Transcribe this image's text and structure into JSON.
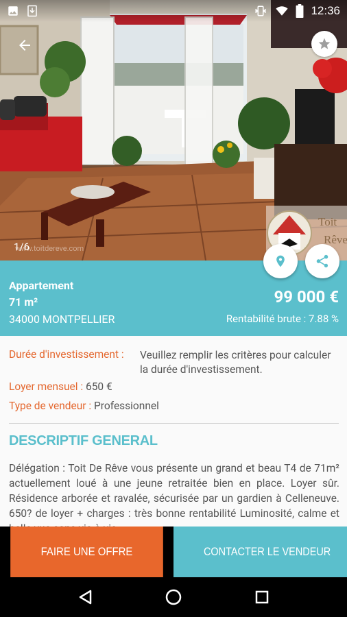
{
  "status_bar": {
    "time": "12:36",
    "icons": [
      "image-icon",
      "download-icon",
      "vibrate-icon",
      "wifi-icon",
      "battery-icon"
    ]
  },
  "gallery": {
    "counter": "1/6",
    "watermark": "www.toitdereve.com",
    "logo_text_top": "Toit",
    "logo_text_bottom": "Rêve"
  },
  "listing": {
    "type": "Appartement",
    "area": "71 m²",
    "city": "34000 MONTPELLIER",
    "price": "99 000 €",
    "yield": "Rentabilité brute : 7.88 %"
  },
  "details": {
    "duration_label": "Durée d'investissement :",
    "duration_value": "Veuillez remplir les critères pour calculer la durée d'investissement.",
    "rent_label": "Loyer mensuel :",
    "rent_value": "650 €",
    "seller_label": "Type de vendeur :",
    "seller_value": "Professionnel",
    "section_title": "DESCRIPTIF GENERAL",
    "description": "Délégation : Toit De Rêve vous présente un grand et beau T4 de 71m² actuellement loué à une jeune retraitée bien en place. Loyer sûr. Résidence arborée et ravalée, sécurisée par un gardien à Celleneuve. 650? de loyer + charges : très bonne rentabilité Luminosité, calme et belle vue sans vis-à-vis"
  },
  "actions": {
    "offer_label": "FAIRE UNE OFFRE",
    "contact_label": "CONTACTER LE VENDEUR"
  },
  "colors": {
    "accent_teal": "#5bbfcc",
    "accent_orange": "#e8672c",
    "label_orange": "#e4672e"
  }
}
